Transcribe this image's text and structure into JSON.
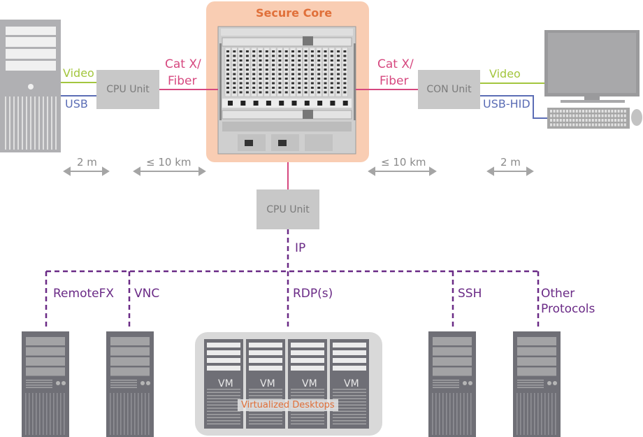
{
  "colors": {
    "core_bg": "#f9cdb3",
    "core_title": "#e0703a",
    "fiber_line": "#d6487f",
    "video_line": "#a3c63e",
    "usb_line": "#5b6db5",
    "ip_line": "#6a2a86",
    "device_gray": "#6f6f76",
    "unit_gray": "#c8c8c8"
  },
  "secure_core": {
    "title": "Secure Core",
    "icon": "matrix-switch-chassis-icon"
  },
  "left": {
    "device_icon": "pc-tower-icon",
    "video_label": "Video",
    "usb_label": "USB",
    "unit_label": "CPU Unit",
    "link_label_line1": "Cat X/",
    "link_label_line2": "Fiber",
    "distance_device": "2 m",
    "distance_link": "≤ 10 km"
  },
  "right": {
    "device_icon": "monitor-keyboard-mouse-icon",
    "video_label": "Video",
    "usb_label": "USB-HID",
    "unit_label": "CON Unit",
    "link_label_line1": "Cat X/",
    "link_label_line2": "Fiber",
    "distance_link": "≤ 10 km",
    "distance_device": "2 m"
  },
  "bottom": {
    "unit_label": "CPU Unit",
    "ip_label": "IP",
    "protocols": [
      {
        "label": "RemoteFX",
        "icon": "server-tower-icon"
      },
      {
        "label": "VNC",
        "icon": "server-tower-icon"
      },
      {
        "label": "RDP(s)",
        "icon": "virtual-machines-icon"
      },
      {
        "label": "SSH",
        "icon": "server-tower-icon"
      },
      {
        "label_line1": "Other",
        "label_line2": "Protocols",
        "icon": "server-tower-icon"
      }
    ],
    "vm_labels": [
      "VM",
      "VM",
      "VM",
      "VM"
    ],
    "virtualized_label": "Virtualized Desktops"
  }
}
